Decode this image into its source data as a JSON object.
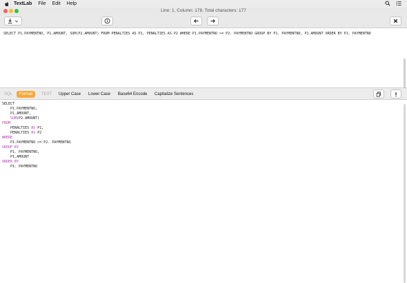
{
  "menubar": {
    "app_name": "TextLab",
    "items": [
      "File",
      "Edit",
      "Help"
    ]
  },
  "window": {
    "status": "Line: 1, Column: 178, Total characters: 177"
  },
  "toolbar": {
    "buttons": [
      "download-menu-icon",
      "info-icon",
      "undo-arrow-icon",
      "redo-arrow-icon",
      "clear-x-icon"
    ]
  },
  "input": {
    "text": "SELECT P1.PAYMENTNO, P1.AMOUNT, SUM(P2.AMOUNT) FROM PENALTIES AS P1, PENALTIES AS P2 WHERE P1.PAYMENTNO >= P2. PAYMENTNO GROUP BY P1. PAYMENTNO, P1.AMOUNT ORDER BY P1. PAYMENTNO"
  },
  "modebar": {
    "sql": "SQL",
    "format": "Format",
    "text": "TEXT",
    "upper": "Upper Case",
    "lower": "Lower Case",
    "base64": "Base64 Encode",
    "capitalize": "Capitalize Sentences"
  },
  "output": {
    "lines": [
      {
        "text": "SELECT",
        "kw": false
      },
      {
        "text": "    P1.PAYMENTNO,",
        "kw": false
      },
      {
        "text": "    P1.AMOUNT,",
        "kw": false
      },
      {
        "pre": "    ",
        "kw_text": "SUM",
        "post": "(P2.AMOUNT)",
        "mixed": true
      },
      {
        "text": "FROM",
        "kw": true
      },
      {
        "text": "    PENALTIES ",
        "kw_text": "AS",
        "post": " P1,",
        "mixed": true,
        "pre": "    PENALTIES "
      },
      {
        "pre": "    PENALTIES ",
        "kw_text": "AS",
        "post": " P2",
        "mixed": true
      },
      {
        "text": "WHERE",
        "kw": true
      },
      {
        "text": "    P1.PAYMENTNO >= P2. PAYMENTNO",
        "kw": false
      },
      {
        "text": "GROUP BY",
        "kw": true
      },
      {
        "text": "    P1. PAYMENTNO,",
        "kw": false
      },
      {
        "text": "    P1.AMOUNT",
        "kw": false
      },
      {
        "text": "ORDER BY",
        "kw": true
      },
      {
        "text": "    P1. PAYMENTNO",
        "kw": false
      }
    ]
  },
  "colors": {
    "keyword": "#b13bb0",
    "accent": "#f6a93b"
  }
}
